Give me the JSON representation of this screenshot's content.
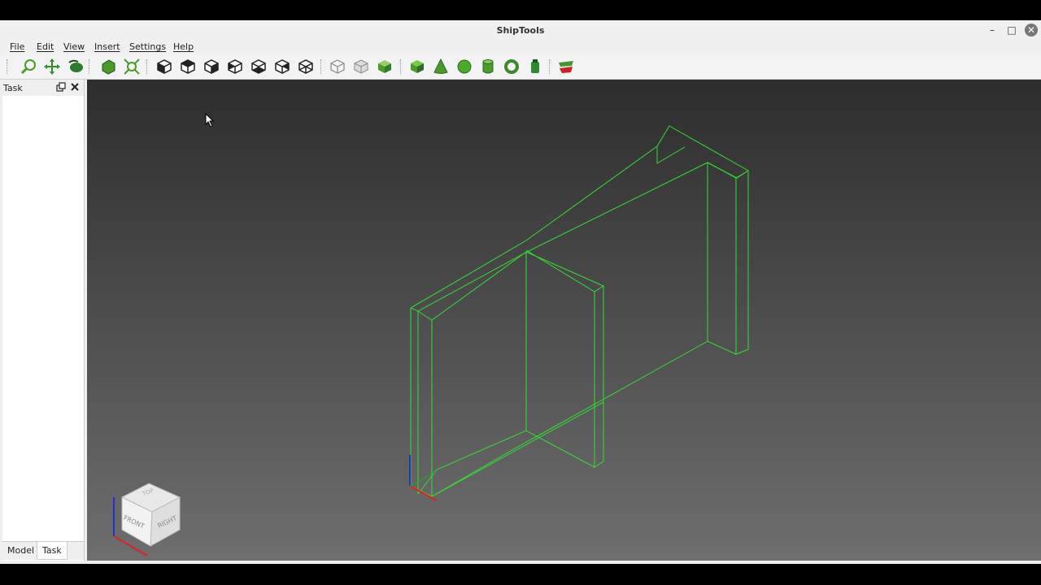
{
  "window": {
    "title": "ShipTools"
  },
  "menu": [
    "File",
    "Edit",
    "View",
    "Insert",
    "Settings",
    "Help"
  ],
  "task_panel": {
    "title": "Task"
  },
  "tabs": {
    "model": "Model",
    "task": "Task"
  },
  "navcube": {
    "top": "TOP",
    "front": "FRONT",
    "right": "RIGHT"
  },
  "colors": {
    "wireframe": "#33dd33",
    "viewport_top": "#2d2d2d",
    "viewport_bottom": "#6e6e6e",
    "axis_x": "#dd2222",
    "axis_y": "#22aa22",
    "axis_z": "#2233cc"
  },
  "toolbar_icons": [
    "zoom-fit-icon",
    "pan-icon",
    "draw-style-icon",
    "std-view-isometric-icon",
    "fit-selection-icon",
    "view-front-icon",
    "view-top-icon",
    "view-right-icon",
    "view-rear-icon",
    "view-bottom-icon",
    "view-left-icon",
    "view-axonometric-icon",
    "wireframe-cube-icon",
    "transparent-cube-icon",
    "shaded-cube-icon",
    "box-icon",
    "cone-icon",
    "sphere-icon",
    "cylinder-icon",
    "torus-icon",
    "tube-icon",
    "ship-hull-icon"
  ]
}
